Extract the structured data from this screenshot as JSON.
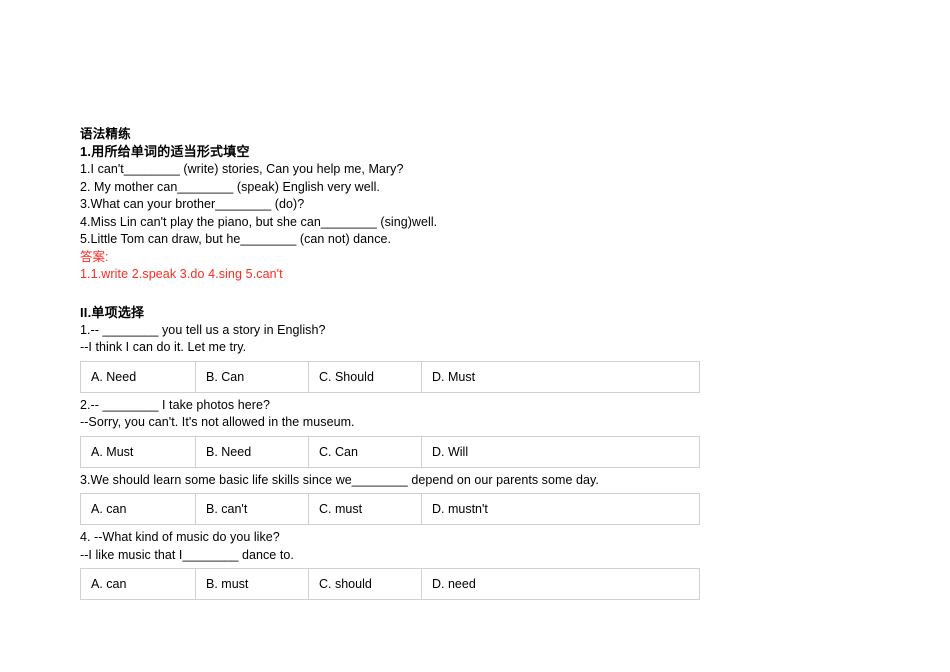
{
  "document": {
    "title": "语法精练",
    "section1": {
      "heading": "1.用所给单词的适当形式填空",
      "questions": [
        "1.I can't________ (write) stories, Can you help me, Mary?",
        "2. My mother can________ (speak) English very well.",
        "3.What can your brother________ (do)?",
        "4.Miss Lin can't play the piano, but she can________ (sing)well.",
        "5.Little Tom can draw, but he________ (can not) dance."
      ],
      "answer_label": "答案:",
      "answer_text": "1.1.write  2.speak  3.do  4.sing  5.can't",
      "answer_color": "#ff2a20"
    },
    "section2": {
      "heading": "II.单项选择",
      "items": [
        {
          "prompt": "1.-- ________ you tell us a story in English?",
          "reply": "--I think I can do it. Let me try.",
          "options": [
            "A. Need",
            "B. Can",
            "C. Should",
            "D. Must"
          ]
        },
        {
          "prompt": "2.-- ________ I take photos here?",
          "reply": "--Sorry, you can't. It's not allowed in the museum.",
          "options": [
            "A. Must",
            "B. Need",
            "C. Can",
            "D. Will"
          ]
        },
        {
          "prompt": "3.We should learn some basic life skills since we________ depend on our parents some day.",
          "reply": "",
          "options": [
            "A. can",
            "B. can't",
            "C. must",
            "D. mustn't"
          ]
        },
        {
          "prompt": "4. --What kind of music do you like?",
          "reply": "--I like music that I________ dance to.",
          "options": [
            "A. can",
            "B. must",
            "C. should",
            "D. need"
          ]
        }
      ]
    }
  }
}
